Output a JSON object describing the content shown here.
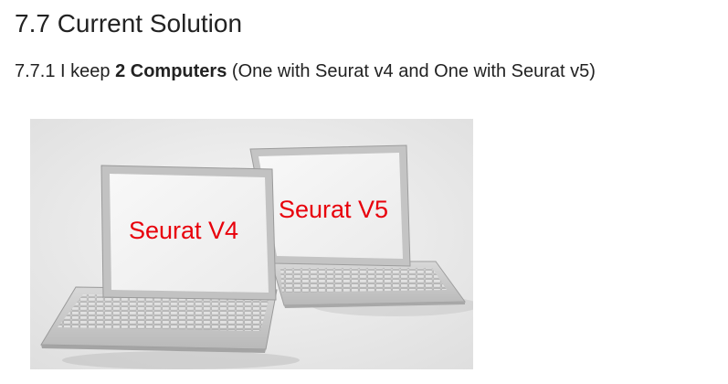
{
  "section": {
    "title": "7.7 Current Solution"
  },
  "subsection": {
    "number": "7.7.1",
    "text_before": "I keep",
    "bold_text": "2 Computers",
    "text_after": "(One with Seurat v4 and One with Seurat v5)"
  },
  "figure": {
    "label_front_laptop": "Seurat V4",
    "label_back_laptop": "Seurat V5",
    "label_color": "#e8000b",
    "background_color": "#e9e9e9"
  }
}
